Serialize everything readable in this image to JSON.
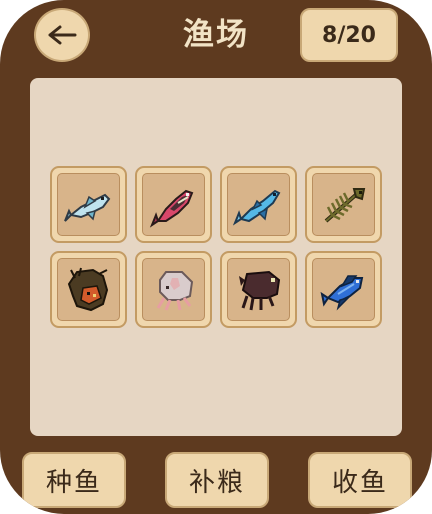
{
  "header": {
    "title": "渔场",
    "counter": "8/20"
  },
  "pond": {
    "fish": [
      {
        "icon": "silver-fish-icon",
        "colors": {
          "body": "#bfe3ef",
          "shade": "#6fb5cc"
        }
      },
      {
        "icon": "red-striped-fish-icon",
        "colors": {
          "body": "#d8476a",
          "shade": "#4b2d34"
        }
      },
      {
        "icon": "blue-fish-icon",
        "colors": {
          "body": "#55b8e6",
          "shade": "#2a6fa5"
        }
      },
      {
        "icon": "fish-skeleton-icon",
        "colors": {
          "body": "#6d6a2b",
          "shade": "#2f2a12"
        }
      },
      {
        "icon": "dark-coelacanth-icon",
        "colors": {
          "body": "#4b3b22",
          "shade": "#d35b2b"
        }
      },
      {
        "icon": "pale-squid-icon",
        "colors": {
          "body": "#d9cccc",
          "shade": "#e79ea2"
        }
      },
      {
        "icon": "dark-squid-icon",
        "colors": {
          "body": "#4a2b2e",
          "shade": "#2a1718"
        }
      },
      {
        "icon": "blue-striped-fish-icon",
        "colors": {
          "body": "#2f6fd6",
          "shade": "#15386b"
        }
      }
    ]
  },
  "actions": {
    "stock_label": "种鱼",
    "feed_label": "补粮",
    "harvest_label": "收鱼"
  },
  "colors": {
    "frame": "#5e3a1f",
    "button": "#efd7ad",
    "pond": "#e6d6c3",
    "slot": "#d8b48a"
  }
}
